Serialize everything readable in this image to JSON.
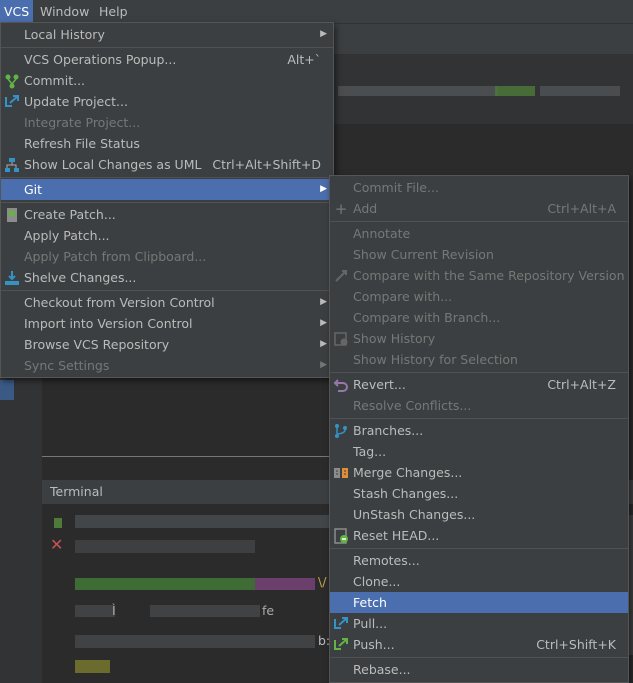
{
  "menubar": {
    "vcs": "VCS",
    "window": "Window",
    "help": "Help"
  },
  "background": {
    "panel_title": "Terminal",
    "fragments": [
      "\\/",
      "Ì",
      "fe",
      "b:"
    ]
  },
  "vcs_menu": {
    "local_history": "Local History",
    "ops_popup": "VCS Operations Popup...",
    "ops_popup_sc": "Alt+`",
    "commit": "Commit...",
    "update_project": "Update Project...",
    "integrate_project": "Integrate Project...",
    "refresh_status": "Refresh File Status",
    "show_local_changes": "Show Local Changes as UML",
    "show_local_changes_sc": "Ctrl+Alt+Shift+D",
    "git": "Git",
    "create_patch": "Create Patch...",
    "apply_patch": "Apply Patch...",
    "apply_patch_clip": "Apply Patch from Clipboard...",
    "shelve": "Shelve Changes...",
    "checkout": "Checkout from Version Control",
    "import": "Import into Version Control",
    "browse_repo": "Browse VCS Repository",
    "sync_settings": "Sync Settings"
  },
  "git_menu": {
    "commit_file": "Commit File...",
    "add": "Add",
    "add_sc": "Ctrl+Alt+A",
    "annotate": "Annotate",
    "show_current_revision": "Show Current Revision",
    "compare_same_repo": "Compare with the Same Repository Version",
    "compare_with": "Compare with...",
    "compare_branch": "Compare with Branch...",
    "show_history": "Show History",
    "show_history_selection": "Show History for Selection",
    "revert": "Revert...",
    "revert_sc": "Ctrl+Alt+Z",
    "resolve_conflicts": "Resolve Conflicts...",
    "branches": "Branches...",
    "tag": "Tag...",
    "merge_changes": "Merge Changes...",
    "stash_changes": "Stash Changes...",
    "unstash_changes": "UnStash Changes...",
    "reset_head": "Reset HEAD...",
    "remotes": "Remotes...",
    "clone": "Clone...",
    "fetch": "Fetch",
    "pull": "Pull...",
    "push": "Push...",
    "push_sc": "Ctrl+Shift+K",
    "rebase": "Rebase..."
  },
  "colors": {
    "selection": "#4b6eaf",
    "menu_bg": "#3c3f41",
    "editor_bg": "#2b2b2b"
  }
}
